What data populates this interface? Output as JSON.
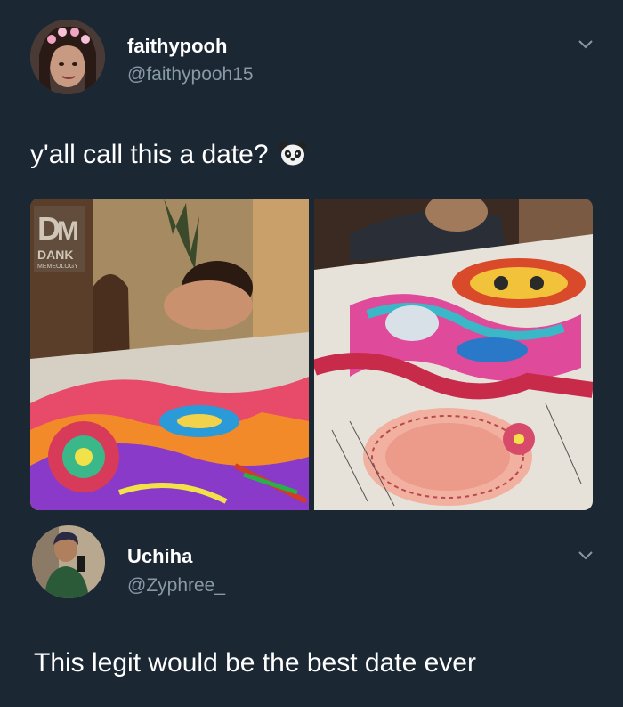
{
  "tweet1": {
    "display_name": "faithypooh",
    "handle": "@faithypooh15",
    "text": "y'all call this a date?",
    "emoji_icon": "panda-face-icon",
    "watermark": "DANK MEMEOLOGY",
    "menu_icon": "chevron-down-icon"
  },
  "tweet2": {
    "display_name": "Uchiha",
    "handle": "@Zyphree_",
    "text": "This legit would be the best date ever",
    "menu_icon": "chevron-down-icon"
  },
  "colors": {
    "background": "#1c2734",
    "handle": "#8899a6",
    "text": "#ffffff"
  }
}
